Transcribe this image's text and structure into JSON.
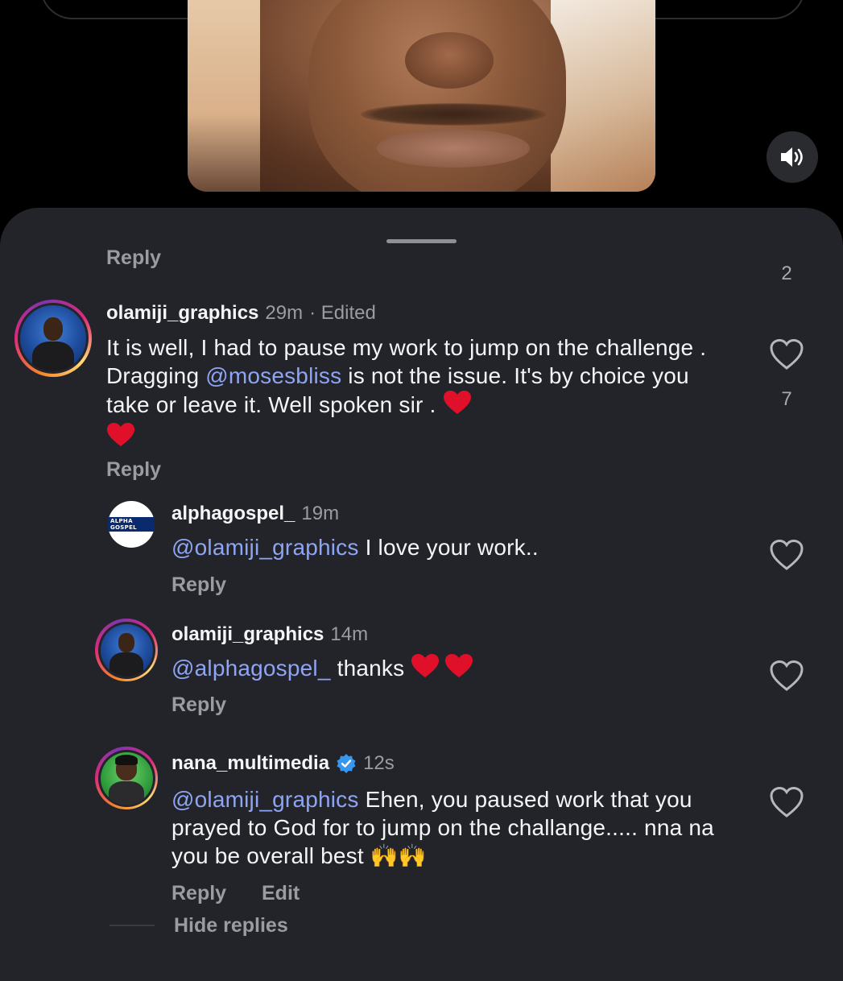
{
  "video": {
    "sound_icon": "speaker-volume-icon"
  },
  "sheet": {
    "top_reply_cutoff": "Reply",
    "top_like_count": "2"
  },
  "comments": [
    {
      "username": "olamiji_graphics",
      "time": "29m",
      "edited": "· Edited",
      "text_part1": "It is well,  I had to pause my work to jump on the challenge .  Dragging ",
      "mention": "@mosesbliss",
      "text_part2": " is not the issue. It's by choice you take or leave it. Well spoken sir . ",
      "like_count": "7",
      "reply_label": "Reply"
    },
    {
      "username": "alphagospel_",
      "time": "19m",
      "avatar_text": "ALPHA GOSPEL",
      "mention": "@olamiji_graphics",
      "text": " I love your work..",
      "reply_label": "Reply"
    },
    {
      "username": "olamiji_graphics",
      "time": "14m",
      "mention": "@alphagospel_",
      "text": " thanks ",
      "reply_label": "Reply"
    },
    {
      "username": "nana_multimedia",
      "time": "12s",
      "verified": true,
      "mention": "@olamiji_graphics",
      "text": " Ehen, you paused work that you prayed to God for to jump on the challange..... nna na you be overall best ",
      "emoji": "🙌🙌",
      "reply_label": "Reply",
      "edit_label": "Edit"
    }
  ],
  "hide_replies": "Hide replies",
  "colors": {
    "background": "#000000",
    "sheet": "#232429",
    "mention": "#8ea4f4",
    "muted": "#9a9ca3",
    "heart_emoji": "#e0102a",
    "verified": "#3797f0"
  }
}
